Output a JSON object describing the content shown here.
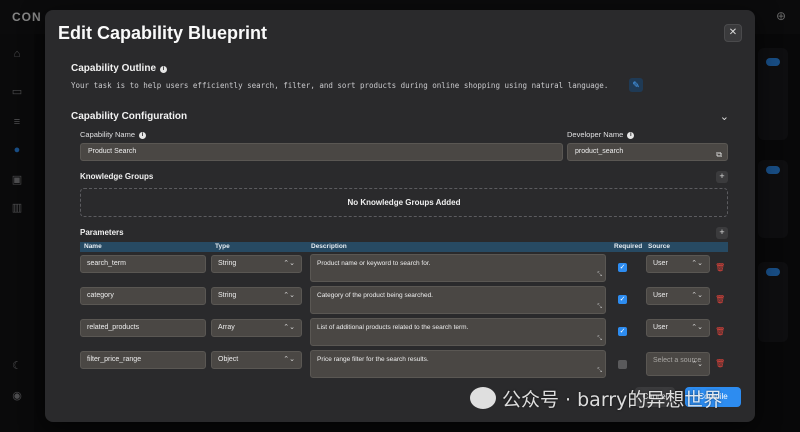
{
  "app": {
    "logo": "CON"
  },
  "modal": {
    "title": "Edit Capability Blueprint",
    "close_label": "✕"
  },
  "outline": {
    "title": "Capability Outline",
    "text": "Your task is to help users efficiently search, filter, and sort products during online shopping using natural language."
  },
  "config": {
    "title": "Capability Configuration",
    "capability_name_label": "Capability Name",
    "capability_name_value": "Product Search",
    "developer_name_label": "Developer Name",
    "developer_name_value": "product_search"
  },
  "knowledge": {
    "title": "Knowledge Groups",
    "empty_text": "No Knowledge Groups Added"
  },
  "parameters": {
    "title": "Parameters",
    "columns": {
      "name": "Name",
      "type": "Type",
      "description": "Description",
      "required": "Required",
      "source": "Source"
    },
    "rows": [
      {
        "name": "search_term",
        "type": "String",
        "description": "Product name or keyword to search for.",
        "required": true,
        "source": "User"
      },
      {
        "name": "category",
        "type": "String",
        "description": "Category of the product being searched.",
        "required": true,
        "source": "User"
      },
      {
        "name": "related_products",
        "type": "Array",
        "description": "List of additional products related to the search term.",
        "required": true,
        "source": "User"
      },
      {
        "name": "filter_price_range",
        "type": "Object",
        "description": "Price range filter for the search results.",
        "required": false,
        "source": "Select a source"
      }
    ]
  },
  "footer": {
    "cancel_label": "Cancel",
    "compile_label": "Compile"
  },
  "watermark": "公众号 · barry的异想世界",
  "colors": {
    "accent": "#2d8cf0",
    "danger": "#e0433b",
    "table_header": "#274a63"
  }
}
